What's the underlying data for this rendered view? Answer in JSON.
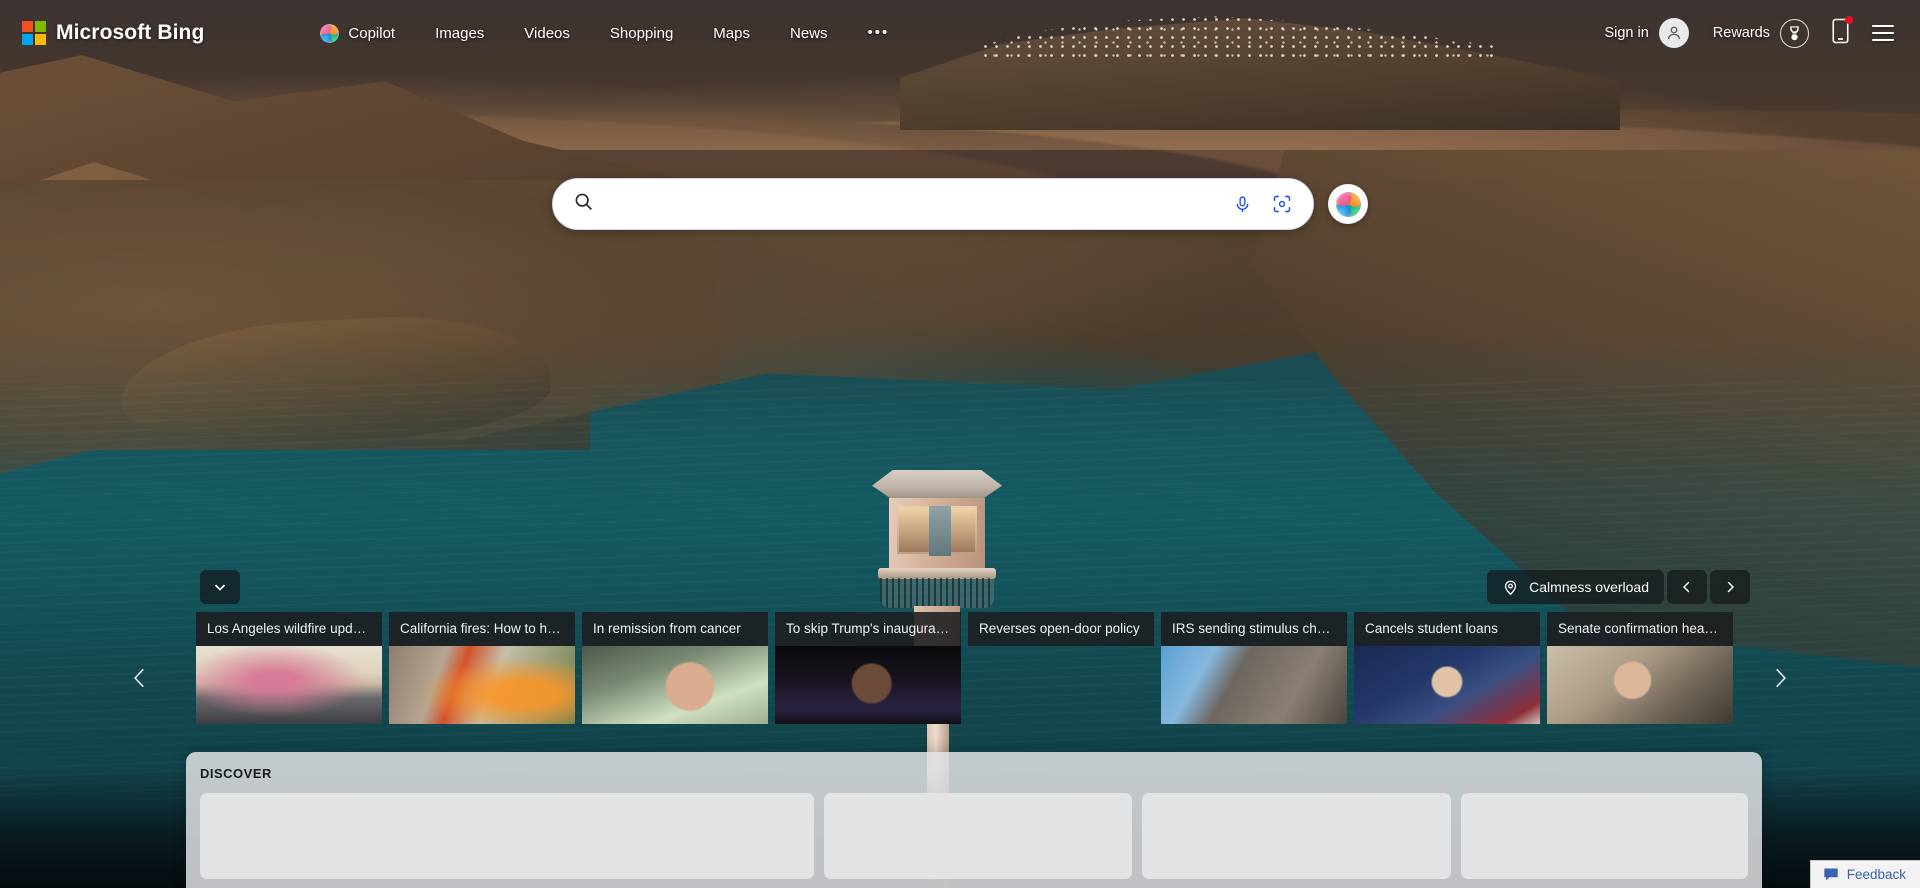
{
  "header": {
    "brand": "Microsoft Bing",
    "logo_colors": [
      "#f25022",
      "#7fba00",
      "#00a4ef",
      "#ffb900"
    ],
    "nav": [
      {
        "label": "Copilot",
        "icon": "copilot-icon"
      },
      {
        "label": "Images",
        "icon": ""
      },
      {
        "label": "Videos",
        "icon": ""
      },
      {
        "label": "Shopping",
        "icon": ""
      },
      {
        "label": "Maps",
        "icon": ""
      },
      {
        "label": "News",
        "icon": ""
      }
    ],
    "more_label": "•••",
    "sign_in_label": "Sign in",
    "rewards_label": "Rewards",
    "phone_icon": "mobile-phone-icon",
    "menu_icon": "hamburger-menu-icon"
  },
  "search": {
    "value": "",
    "placeholder": "",
    "search_icon": "search-icon",
    "mic_icon": "microphone-icon",
    "camera_icon": "visual-search-camera-icon",
    "copilot_button_icon": "copilot-icon"
  },
  "background": {
    "scroll_down_icon": "chevron-down-icon",
    "info_label": "Calmness overload",
    "info_icon": "location-pin-icon",
    "prev_icon": "chevron-left-icon",
    "next_icon": "chevron-right-icon"
  },
  "carousel": {
    "prev_icon": "chevron-left-icon",
    "next_icon": "chevron-right-icon",
    "cards": [
      {
        "title": "Los Angeles wildfire updates",
        "thumb_class": "t-wildfire"
      },
      {
        "title": "California fires: How to help",
        "thumb_class": "t-help"
      },
      {
        "title": "In remission from cancer",
        "thumb_class": "t-kate"
      },
      {
        "title": "To skip Trump's inauguration",
        "thumb_class": "t-michelle"
      },
      {
        "title": "Reverses open-door policy",
        "thumb_class": "t-starbucks"
      },
      {
        "title": "IRS sending stimulus che…",
        "thumb_class": "t-irs"
      },
      {
        "title": "Cancels student loans",
        "thumb_class": "t-biden"
      },
      {
        "title": "Senate confirmation hearing",
        "thumb_class": "t-hegseth"
      }
    ]
  },
  "discover": {
    "title": "DISCOVER",
    "placeholder_cards": 4
  },
  "feedback": {
    "label": "Feedback",
    "icon": "speech-bubble-icon",
    "color": "#3a63b0"
  }
}
